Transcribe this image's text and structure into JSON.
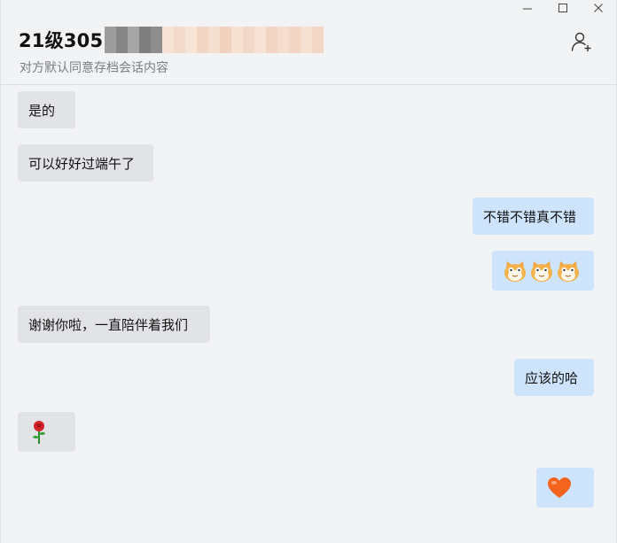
{
  "window": {
    "controls": [
      "minimize",
      "maximize",
      "close"
    ]
  },
  "header": {
    "title": "21级305",
    "subtitle": "对方默认同意存档会话内容",
    "title_redacted": true
  },
  "colors": {
    "background": "#f2f3f5",
    "incoming_bubble": "#e2e3e6",
    "outgoing_bubble": "#cde4fc"
  },
  "messages": [
    {
      "side": "in",
      "type": "text",
      "text": "是的"
    },
    {
      "side": "in",
      "type": "text",
      "text": "可以好好过端午了"
    },
    {
      "side": "out",
      "type": "text",
      "text": "不错不错真不错"
    },
    {
      "side": "out",
      "type": "emoji",
      "emoji": [
        "cat-face-icon",
        "cat-face-icon",
        "cat-face-icon"
      ]
    },
    {
      "side": "in",
      "type": "text",
      "text": "谢谢你啦，一直陪伴着我们"
    },
    {
      "side": "out",
      "type": "text",
      "text": "应该的哈"
    },
    {
      "side": "in",
      "type": "emoji",
      "emoji": [
        "rose-icon"
      ]
    },
    {
      "side": "out",
      "type": "emoji",
      "emoji": [
        "heart-icon"
      ]
    }
  ]
}
